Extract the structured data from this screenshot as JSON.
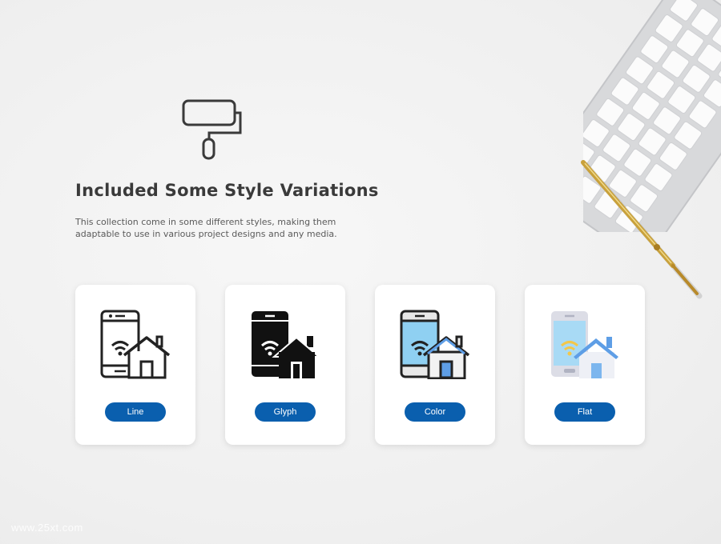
{
  "heading": "Included Some Style Variations",
  "description": "This collection come in some different styles, making them adaptable to use in various project designs and any media.",
  "cards": [
    {
      "label": "Line",
      "icon": "smart-home-phone-line-icon"
    },
    {
      "label": "Glyph",
      "icon": "smart-home-phone-glyph-icon"
    },
    {
      "label": "Color",
      "icon": "smart-home-phone-color-icon"
    },
    {
      "label": "Flat",
      "icon": "smart-home-phone-flat-icon"
    }
  ],
  "decor": {
    "roller_icon": "paint-roller-icon",
    "keyboard": "keyboard-photo",
    "pen": "gold-pen-photo"
  },
  "watermark": "www.25xt.com",
  "colors": {
    "button": "#0a5fae",
    "accent_blue": "#7cc4ee",
    "house_blue": "#5e9ee6",
    "wifi_yellow": "#f3c74a"
  }
}
